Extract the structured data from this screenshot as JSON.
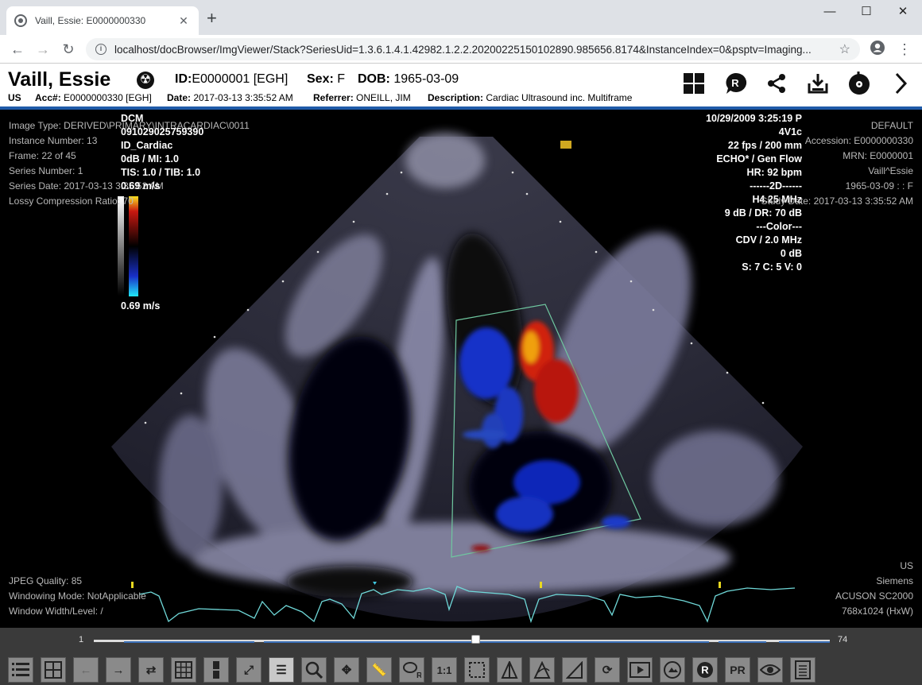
{
  "browser": {
    "tab_title": "Vaill, Essie: E0000000330",
    "url": "localhost/docBrowser/ImgViewer/Stack?SeriesUid=1.3.6.1.4.1.42982.1.2.2.20200225150102890.985656.8174&InstanceIndex=0&psptv=Imaging..."
  },
  "patient": {
    "name": "Vaill, Essie",
    "id_label": "ID:",
    "id_value": "E0000001 [EGH]",
    "sex_label": "Sex:",
    "sex_value": "F",
    "dob_label": "DOB:",
    "dob_value": "1965-03-09",
    "modality": "US",
    "acc_label": "Acc#:",
    "acc_value": "E0000000330 [EGH]",
    "date_label": "Date:",
    "date_value": "2017-03-13 3:35:52 AM",
    "referrer_label": "Referrer:",
    "referrer_value": "ONEILL, JIM",
    "description_label": "Description:",
    "description_value": "Cardiac Ultrasound inc. Multiframe"
  },
  "overlay_tl": [
    "Image Type: DERIVED\\PRIMARY\\INTRACARDIAC\\0011",
    "Instance Number: 13",
    "Frame: 22 of 45",
    "Series Number: 1",
    "Series Date: 2017-03-13 3:35:52 AM",
    "Lossy Compression Ratio: 70"
  ],
  "us_tl": [
    "DCM",
    "091029025759390",
    "ID_Cardiac",
    "0dB / MI: 1.0",
    "TIS: 1.0 / TIB: 1.0",
    "0.69 m/s"
  ],
  "scale_bottom": "0.69 m/s",
  "us_tr": [
    "10/29/2009 3:25:19 P",
    "4V1c",
    "22 fps / 200 mm",
    "ECHO* / Gen Flow",
    "HR: 92 bpm",
    "------2D------",
    "H4.25 MHz",
    "9 dB / DR: 70 dB",
    "---Color---",
    "CDV / 2.0 MHz",
    "0 dB",
    "S: 7 C: 5 V: 0"
  ],
  "overlay_tr": [
    "DEFAULT",
    "Accession: E0000000330",
    "MRN: E0000001",
    "Vaill^Essie",
    "1965-03-09 : : F",
    "Study Date: 2017-03-13 3:35:52 AM"
  ],
  "overlay_bl": [
    "JPEG Quality: 85",
    "Windowing Mode: NotApplicable",
    "Window Width/Level: /"
  ],
  "overlay_br": [
    "US",
    "Siemens",
    "ACUSON SC2000",
    "768x1024 (HxW)"
  ],
  "slider": {
    "min": "1",
    "max": "74"
  },
  "toolbar": [
    "list-icon",
    "grid-icon",
    "back-icon",
    "forward-icon",
    "swap-icon",
    "layout-grid-icon",
    "split-icon",
    "fit-icon",
    "stack-icon",
    "zoom-icon",
    "pan-icon",
    "ruler-icon",
    "roi-icon",
    "1:1",
    "frame-icon",
    "cine-ap-icon",
    "cine-hc-icon",
    "cine-sp-icon",
    "refresh-icon",
    "video-icon",
    "photo-icon",
    "r-icon",
    "PR",
    "eye-icon",
    "report-icon"
  ]
}
